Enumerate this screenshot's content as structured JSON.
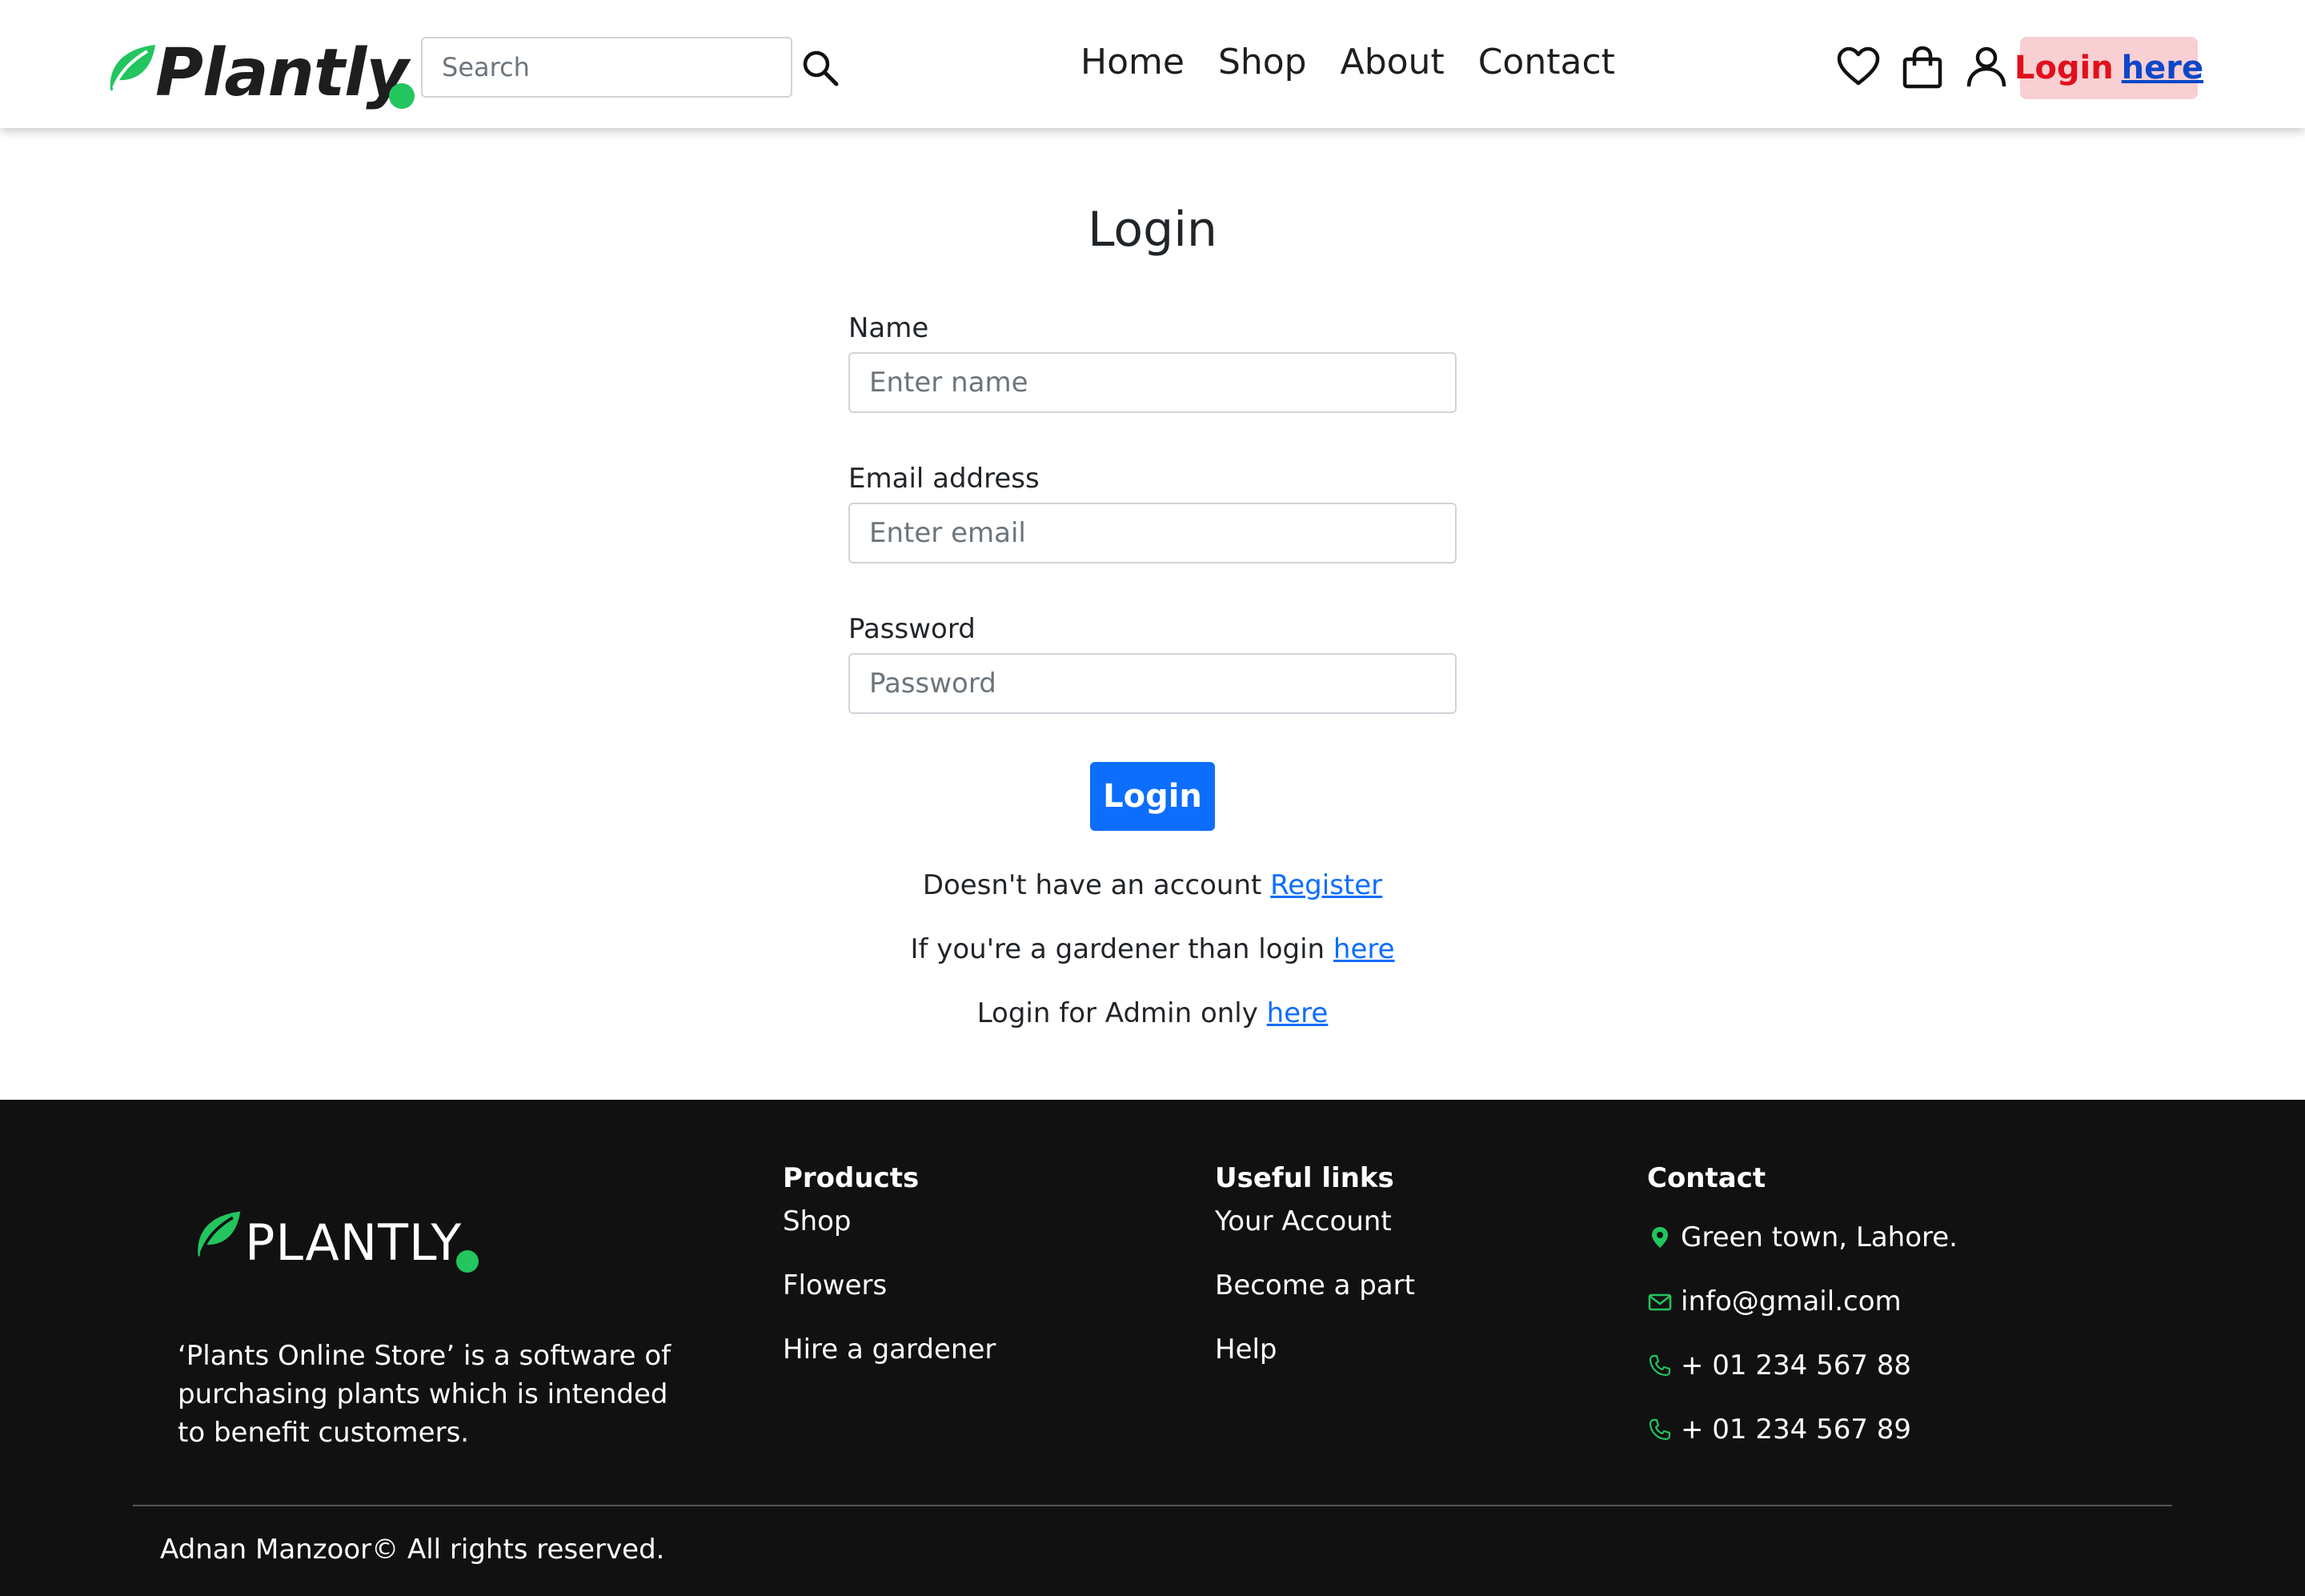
{
  "header": {
    "brand": "Plantly",
    "search": {
      "placeholder": "Search"
    },
    "nav": [
      "Home",
      "Shop",
      "About",
      "Contact"
    ],
    "icons": [
      "heart-icon",
      "shopping-bag-icon",
      "user-icon"
    ],
    "login_prefix": "Login",
    "login_link": "here"
  },
  "main": {
    "title": "Login",
    "fields": [
      {
        "label": "Name",
        "placeholder": "Enter name",
        "value": ""
      },
      {
        "label": "Email address",
        "placeholder": "Enter email",
        "value": ""
      },
      {
        "label": "Password",
        "placeholder": "Password",
        "value": ""
      }
    ],
    "submit_label": "Login",
    "links": [
      {
        "text": "Doesn't have an account ",
        "link": "Register"
      },
      {
        "text": "If you're a gardener than login ",
        "link": "here"
      },
      {
        "text": "Login for Admin only ",
        "link": "here"
      }
    ]
  },
  "footer": {
    "brand": "PLANTLY",
    "about": "‘Plants Online Store’ is a software of purchasing plants which is intended to benefit customers.",
    "products": {
      "title": "Products",
      "items": [
        "Shop",
        "Flowers",
        "Hire a gardener"
      ]
    },
    "useful_links": {
      "title": "Useful links",
      "items": [
        "Your Account",
        "Become a part",
        "Help"
      ]
    },
    "contact": {
      "title": "Contact",
      "address": "Green town, Lahore.",
      "email": "info@gmail.com",
      "phones": [
        "+ 01 234 567 88",
        "+ 01 234 567 89"
      ]
    },
    "copyright": "Adnan Manzoor© All rights reserved."
  },
  "colors": {
    "brand_green": "#22c55e",
    "primary_blue": "#0d6efd",
    "login_pill_bg": "#f8cfd2",
    "login_red": "#e0101c",
    "footer_bg": "#111111"
  }
}
